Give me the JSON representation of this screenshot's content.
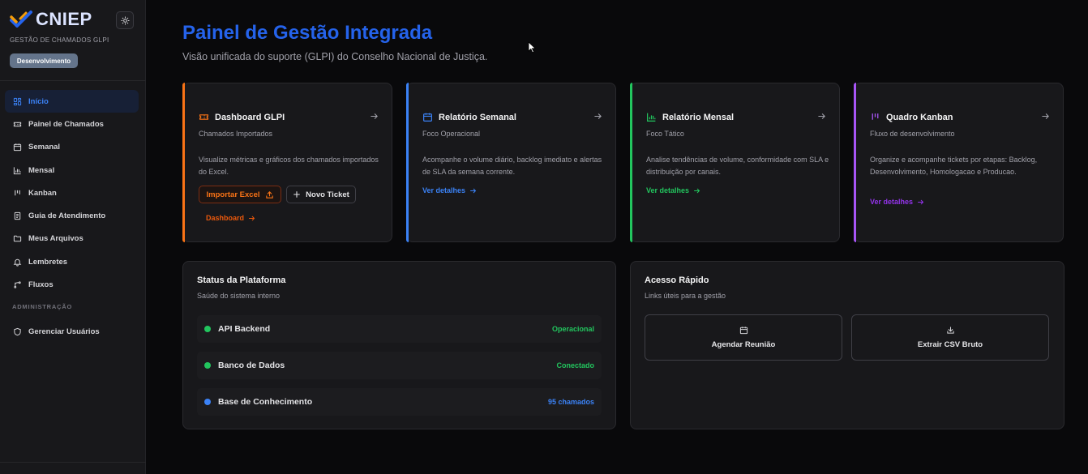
{
  "brand": {
    "name": "CNIEP",
    "subtitle": "GESTÃO DE CHAMADOS GLPI",
    "environment": "Desenvolvimento",
    "theme_icon": "sun-icon"
  },
  "sidebar": {
    "items": [
      {
        "label": "Início",
        "icon": "grid-icon",
        "active": true
      },
      {
        "label": "Painel de Chamados",
        "icon": "ticket-icon"
      },
      {
        "label": "Semanal",
        "icon": "calendar-icon"
      },
      {
        "label": "Mensal",
        "icon": "bar-chart-icon"
      },
      {
        "label": "Kanban",
        "icon": "kanban-icon"
      },
      {
        "label": "Guia de Atendimento",
        "icon": "book-icon"
      },
      {
        "label": "Meus Arquivos",
        "icon": "folder-icon"
      },
      {
        "label": "Lembretes",
        "icon": "bell-icon"
      },
      {
        "label": "Fluxos",
        "icon": "workflow-icon"
      }
    ],
    "admin_section": "ADMINISTRAÇÃO",
    "admin_items": [
      {
        "label": "Gerenciar Usuários",
        "icon": "shield-icon"
      }
    ]
  },
  "page": {
    "title": "Painel de Gestão Integrada",
    "subtitle": "Visão unificada do suporte (GLPI) do Conselho Nacional de Justiça."
  },
  "cards": [
    {
      "title": "Dashboard GLPI",
      "subtitle": "Chamados Importados",
      "description": "Visualize métricas e gráficos dos chamados importados do Excel.",
      "accent": "#f97316",
      "icon": "ticket-icon",
      "buttons": {
        "import": "Importar Excel",
        "new_ticket": "Novo Ticket"
      },
      "link": "Dashboard"
    },
    {
      "title": "Relatório Semanal",
      "subtitle": "Foco Operacional",
      "description": "Acompanhe o volume diário, backlog imediato e alertas de SLA da semana corrente.",
      "accent": "#3b82f6",
      "icon": "calendar-icon",
      "link": "Ver detalhes"
    },
    {
      "title": "Relatório Mensal",
      "subtitle": "Foco Tático",
      "description": "Analise tendências de volume, conformidade com SLA e distribuição por canais.",
      "accent": "#22c55e",
      "icon": "bar-chart-icon",
      "link": "Ver detalhes"
    },
    {
      "title": "Quadro Kanban",
      "subtitle": "Fluxo de desenvolvimento",
      "description": "Organize e acompanhe tickets por etapas: Backlog, Desenvolvimento, Homologacao e Producao.",
      "accent": "#a855f7",
      "icon": "kanban-icon",
      "link": "Ver detalhes"
    }
  ],
  "status": {
    "title": "Status da Plataforma",
    "subtitle": "Saúde do sistema interno",
    "rows": [
      {
        "name": "API Backend",
        "value": "Operacional",
        "color": "#22c55e"
      },
      {
        "name": "Banco de Dados",
        "value": "Conectado",
        "color": "#22c55e"
      },
      {
        "name": "Base de Conhecimento",
        "value": "95 chamados",
        "color": "#3b82f6"
      }
    ]
  },
  "quick_access": {
    "title": "Acesso Rápido",
    "subtitle": "Links úteis para a gestão",
    "buttons": [
      {
        "label": "Agendar Reunião",
        "icon": "calendar-icon"
      },
      {
        "label": "Extrair CSV Bruto",
        "icon": "download-icon"
      }
    ]
  }
}
